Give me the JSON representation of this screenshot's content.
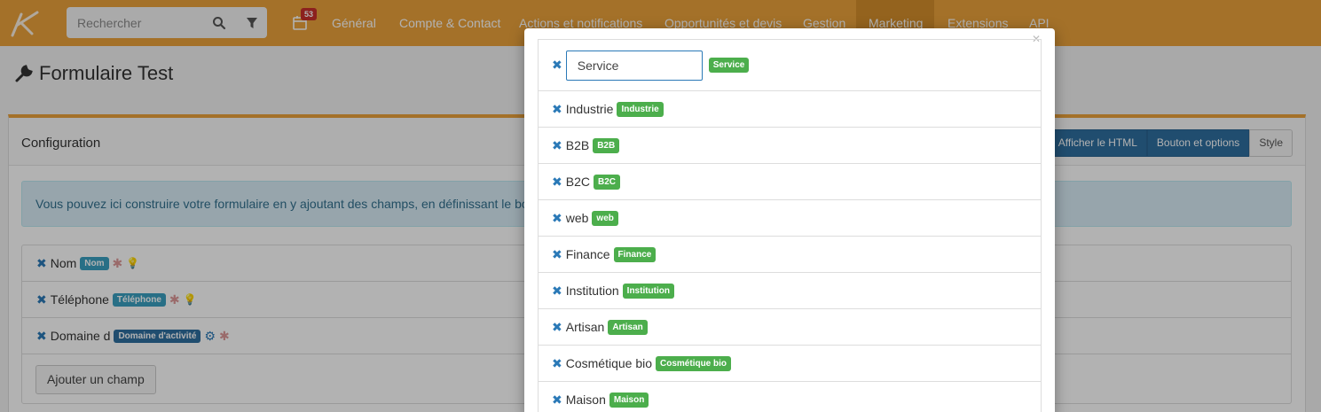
{
  "navbar": {
    "search_placeholder": "Rechercher",
    "notif_count": "53",
    "items": [
      {
        "label": "Général"
      },
      {
        "label": "Compte & Contact"
      },
      {
        "label": "Actions et notifications"
      },
      {
        "label": "Opportunités et devis"
      },
      {
        "label": "Gestion"
      },
      {
        "label": "Marketing"
      },
      {
        "label": "Extensions"
      },
      {
        "label": "API"
      }
    ],
    "active_item": "Marketing",
    "colors": {
      "bar": "#eba33b",
      "active": "#d58f2b"
    }
  },
  "page": {
    "title": "Formulaire Test",
    "title_icon": "wrench-icon"
  },
  "config": {
    "title": "Configuration",
    "buttons": {
      "html": "Afficher le HTML",
      "options": "Bouton et options",
      "style": "Style"
    },
    "alert": "Vous pouvez ici construire votre formulaire en y ajoutant des champs, en définissant le bouton",
    "fields": [
      {
        "name": "Nom",
        "tag": "Nom"
      },
      {
        "name": "Téléphone",
        "tag": "Téléphone"
      },
      {
        "name": "Domaine d",
        "tag": "Domaine d'activité"
      }
    ],
    "add_field": "Ajouter un champ"
  },
  "modal": {
    "input_value": "Service",
    "input_tag": "Service",
    "options": [
      {
        "label": "Industrie",
        "tag": "Industrie"
      },
      {
        "label": "B2B",
        "tag": "B2B"
      },
      {
        "label": "B2C",
        "tag": "B2C"
      },
      {
        "label": "web",
        "tag": "web"
      },
      {
        "label": "Finance",
        "tag": "Finance"
      },
      {
        "label": "Institution",
        "tag": "Institution"
      },
      {
        "label": "Artisan",
        "tag": "Artisan"
      },
      {
        "label": "Cosmétique bio",
        "tag": "Cosmétique bio"
      },
      {
        "label": "Maison",
        "tag": "Maison"
      }
    ],
    "tag_color": "#4cae4c"
  }
}
